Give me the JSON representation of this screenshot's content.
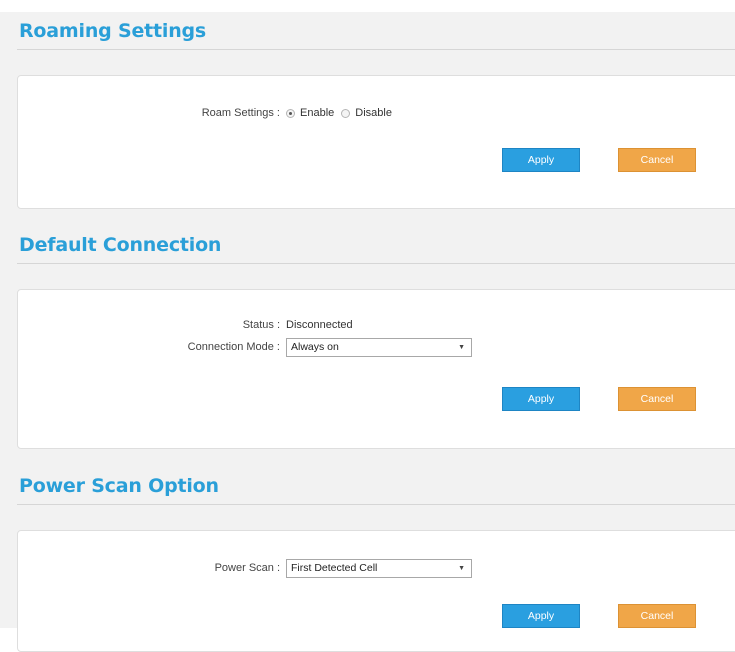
{
  "roaming": {
    "title": "Roaming Settings",
    "roam_label": "Roam Settings :",
    "options": [
      "Enable",
      "Disable"
    ],
    "selected": "Enable",
    "apply_label": "Apply",
    "cancel_label": "Cancel"
  },
  "default_connection": {
    "title": "Default Connection",
    "status_label": "Status :",
    "status_value": "Disconnected",
    "mode_label": "Connection Mode :",
    "mode_value": "Always on",
    "apply_label": "Apply",
    "cancel_label": "Cancel"
  },
  "power_scan": {
    "title": "Power Scan Option",
    "scan_label": "Power Scan :",
    "scan_value": "First Detected Cell",
    "apply_label": "Apply",
    "cancel_label": "Cancel"
  },
  "icons": {
    "radio_checked": "radio-checked-icon",
    "radio_unchecked": "radio-unchecked-icon",
    "dropdown": "dropdown-caret-icon"
  },
  "colors": {
    "accent": "#2a9fd8",
    "apply": "#2a9fe0",
    "cancel": "#f0a648",
    "background": "#f2f2f2"
  }
}
